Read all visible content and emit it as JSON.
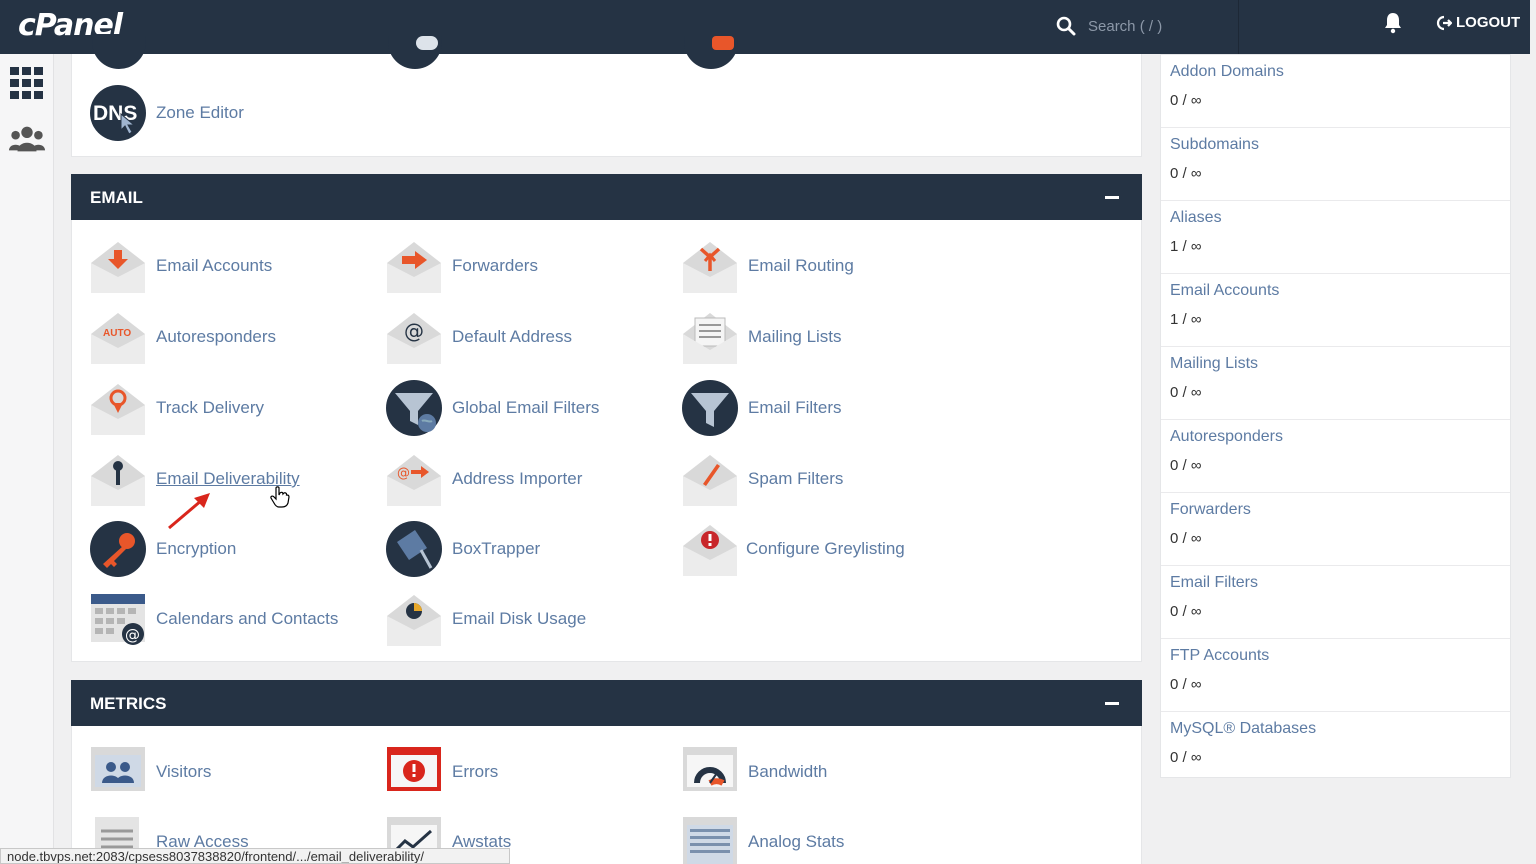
{
  "header": {
    "logo": "cPanel",
    "search_placeholder": "Search ( / )",
    "logout_label": "LOGOUT"
  },
  "rail": {
    "icons": [
      "grid-icon",
      "users-icon"
    ]
  },
  "domains_section": {
    "partial_item": "Zone Editor"
  },
  "email_section": {
    "title": "EMAIL",
    "items": [
      "Email Accounts",
      "Forwarders",
      "Email Routing",
      "Autoresponders",
      "Default Address",
      "Mailing Lists",
      "Track Delivery",
      "Global Email Filters",
      "Email Filters",
      "Email Deliverability",
      "Address Importer",
      "Spam Filters",
      "Encryption",
      "BoxTrapper",
      "Configure Greylisting",
      "Calendars and Contacts",
      "Email Disk Usage"
    ]
  },
  "metrics_section": {
    "title": "METRICS",
    "items": [
      "Visitors",
      "Errors",
      "Bandwidth",
      "Raw Access",
      "Awstats",
      "Analog Stats"
    ]
  },
  "stats": [
    {
      "name": "Addon Domains",
      "value": "0 / ∞"
    },
    {
      "name": "Subdomains",
      "value": "0 / ∞"
    },
    {
      "name": "Aliases",
      "value": "1 / ∞"
    },
    {
      "name": "Email Accounts",
      "value": "1 / ∞"
    },
    {
      "name": "Mailing Lists",
      "value": "0 / ∞"
    },
    {
      "name": "Autoresponders",
      "value": "0 / ∞"
    },
    {
      "name": "Forwarders",
      "value": "0 / ∞"
    },
    {
      "name": "Email Filters",
      "value": "0 / ∞"
    },
    {
      "name": "FTP Accounts",
      "value": "0 / ∞"
    },
    {
      "name": "MySQL® Databases",
      "value": "0 / ∞"
    }
  ],
  "status_bar": "node.tbvps.net:2083/cpsess8037838820/frontend/.../email_deliverability/",
  "colors": {
    "header_bg": "#253344",
    "link": "#5d7ba3",
    "accent": "#e8562a"
  }
}
